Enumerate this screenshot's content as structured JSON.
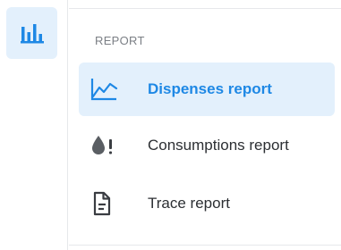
{
  "rail": {
    "active_icon": "bar-chart-icon",
    "accent_color": "#1e88e5"
  },
  "menu": {
    "section_title": "REPORT",
    "items": [
      {
        "label": "Dispenses report",
        "icon": "line-chart-icon",
        "active": true
      },
      {
        "label": "Consumptions report",
        "icon": "drop-alert-icon",
        "active": false
      },
      {
        "label": "Trace report",
        "icon": "document-icon",
        "active": false
      }
    ]
  }
}
